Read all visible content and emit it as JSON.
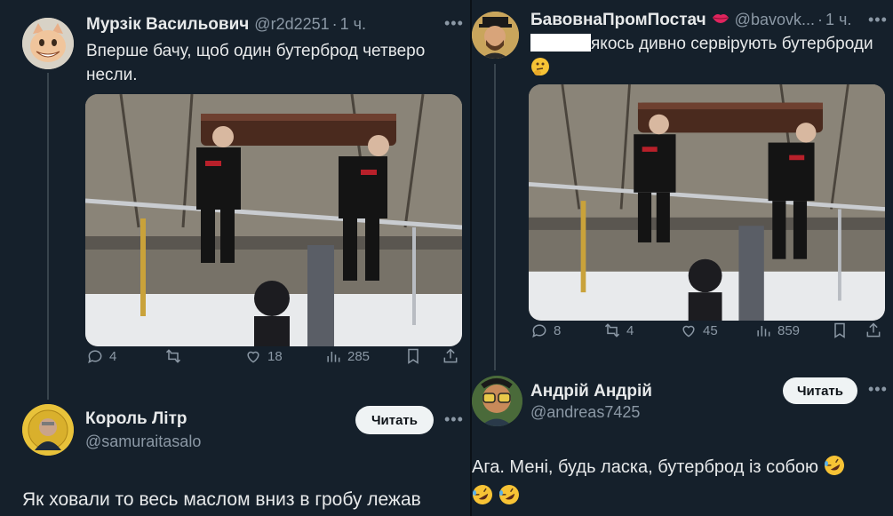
{
  "left": {
    "tweet": {
      "display_name": "Мурзік Васильович",
      "handle": "@r2d2251",
      "dot": "·",
      "time": "1 ч.",
      "text": "Вперше бачу, щоб один бутерброд четверо несли.",
      "stats": {
        "replies": "4",
        "reposts": "",
        "likes": "18",
        "views": "285"
      },
      "icons": [
        "reply-icon",
        "repost-icon",
        "like-icon",
        "views-icon",
        "bookmark-icon",
        "share-icon"
      ]
    },
    "reply": {
      "display_name": "Король Літр",
      "handle": "@samuraitasalo",
      "follow_label": "Читать",
      "text": "Як ховали то весь маслом вниз в гробу лежав"
    }
  },
  "right": {
    "tweet": {
      "display_name": "БавовнаПромПостач",
      "handle": "@bavovk...",
      "dot": "·",
      "time": "1 ч.",
      "text": "якось дивно сервірують бутерброди",
      "stats": {
        "replies": "8",
        "reposts": "4",
        "likes": "45",
        "views": "859"
      },
      "icons": [
        "reply-icon",
        "repost-icon",
        "like-icon",
        "views-icon",
        "bookmark-icon",
        "share-icon"
      ]
    },
    "reply": {
      "display_name": "Андрій Андрій",
      "handle": "@andreas7425",
      "follow_label": "Читать",
      "text": "Ага. Мені, будь ласка, бутерброд із собою"
    }
  },
  "colors": {
    "background": "#15202b",
    "text": "#e7e9ea",
    "muted": "#8b98a5",
    "button_bg": "#eff3f4"
  }
}
